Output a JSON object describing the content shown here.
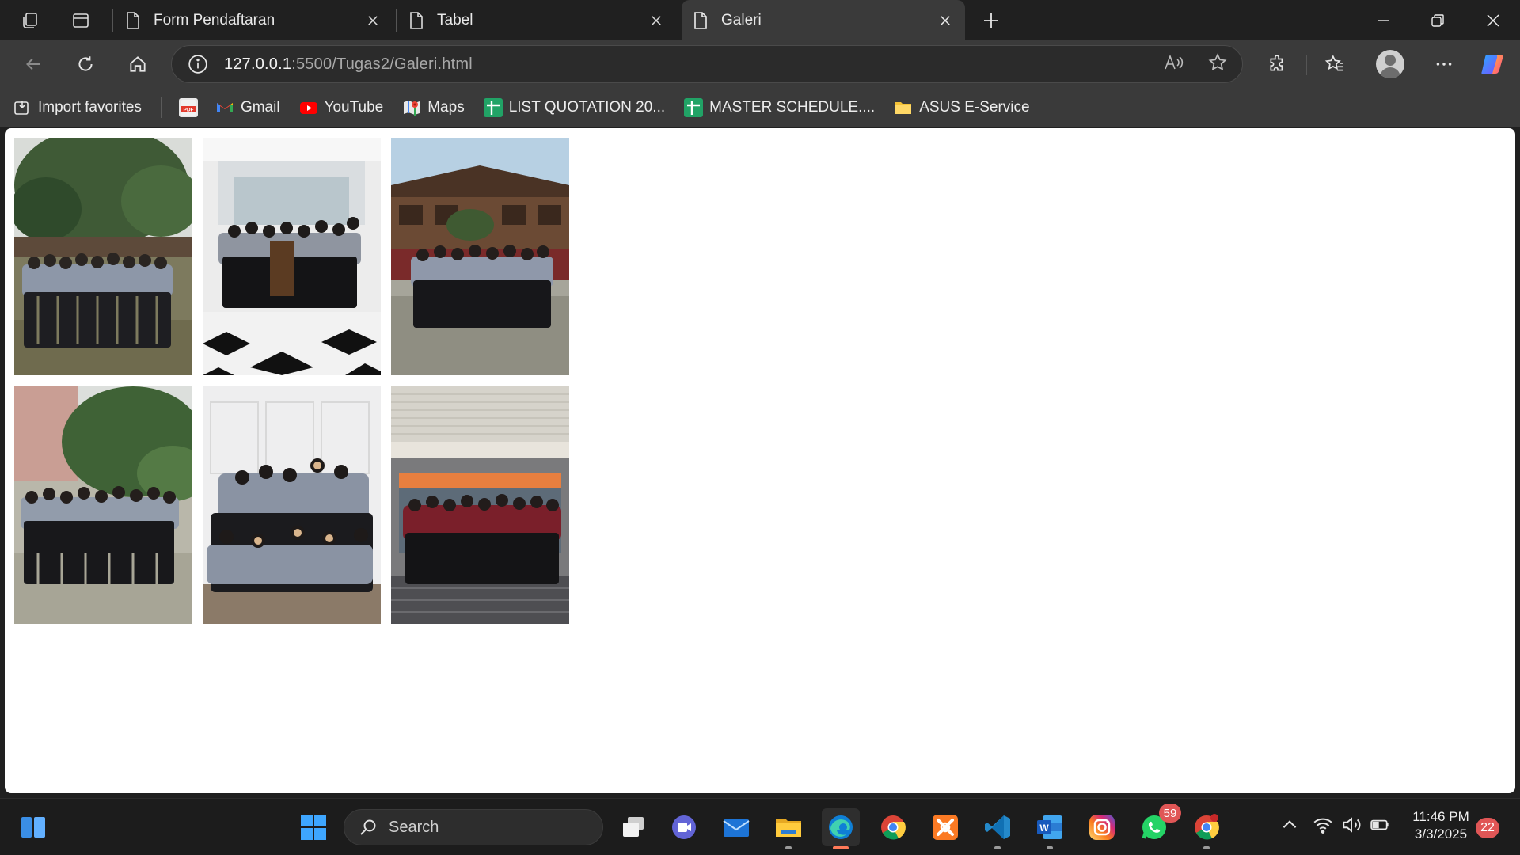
{
  "browser": {
    "tabs": [
      {
        "title": "Form Pendaftaran",
        "active": false
      },
      {
        "title": "Tabel",
        "active": false
      },
      {
        "title": "Galeri",
        "active": true
      }
    ],
    "address": {
      "host": "127.0.0.1",
      "path": ":5500/Tugas2/Galeri.html"
    },
    "favorites": [
      {
        "label": "Import favorites",
        "icon": "import-icon"
      },
      {
        "label": "",
        "icon": "pdf-icon"
      },
      {
        "label": "Gmail",
        "icon": "gmail-icon"
      },
      {
        "label": "YouTube",
        "icon": "youtube-icon"
      },
      {
        "label": "Maps",
        "icon": "maps-icon"
      },
      {
        "label": "LIST QUOTATION 20...",
        "icon": "sheets-icon"
      },
      {
        "label": "MASTER SCHEDULE....",
        "icon": "sheets-icon"
      },
      {
        "label": "ASUS E-Service",
        "icon": "folder-icon"
      }
    ]
  },
  "page": {
    "photos": [
      {
        "scene": "group-outdoor-trees"
      },
      {
        "scene": "group-indoor-white-hall"
      },
      {
        "scene": "group-wooden-building"
      },
      {
        "scene": "group-outdoor-pink-wall"
      },
      {
        "scene": "group-indoor-seated"
      },
      {
        "scene": "group-building-entrance"
      }
    ]
  },
  "taskbar": {
    "search_placeholder": "Search",
    "whatsapp_badge": "59",
    "time": "11:46 PM",
    "date": "3/3/2025",
    "notifications": "22"
  },
  "colors": {
    "chrome_dark": "#202020",
    "chrome_toolbar": "#3a3a3a",
    "page_bg": "#ffffff",
    "edge_accent": "#ff7a59"
  }
}
